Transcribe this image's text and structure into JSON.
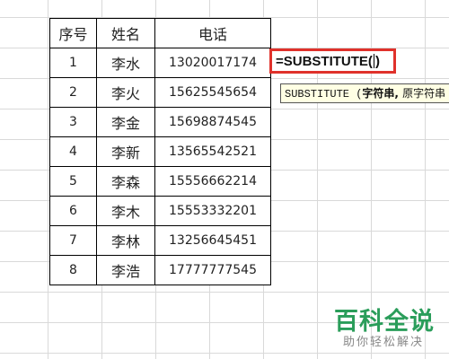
{
  "table": {
    "headers": [
      "序号",
      "姓名",
      "电话"
    ],
    "rows": [
      {
        "no": "1",
        "name": "李水",
        "phone": "13020017174"
      },
      {
        "no": "2",
        "name": "李火",
        "phone": "15625545654"
      },
      {
        "no": "3",
        "name": "李金",
        "phone": "15698874545"
      },
      {
        "no": "4",
        "name": "李新",
        "phone": "13565542521"
      },
      {
        "no": "5",
        "name": "李森",
        "phone": "15556662214"
      },
      {
        "no": "6",
        "name": "李木",
        "phone": "15553332201"
      },
      {
        "no": "7",
        "name": "李林",
        "phone": "13256645451"
      },
      {
        "no": "8",
        "name": "李浩",
        "phone": "17777777545"
      }
    ]
  },
  "formula": {
    "before_cursor": "=SUBSTITUTE(",
    "after_cursor": ")"
  },
  "tooltip": {
    "func": "SUBSTITUTE (",
    "args": "字符串, ",
    "rest": "原字符串"
  },
  "watermark": {
    "logo": "百科全说",
    "slogan": "助你轻松解决"
  },
  "colors": {
    "highlight": "#e0312b",
    "watermark": "#2a9d5a"
  }
}
